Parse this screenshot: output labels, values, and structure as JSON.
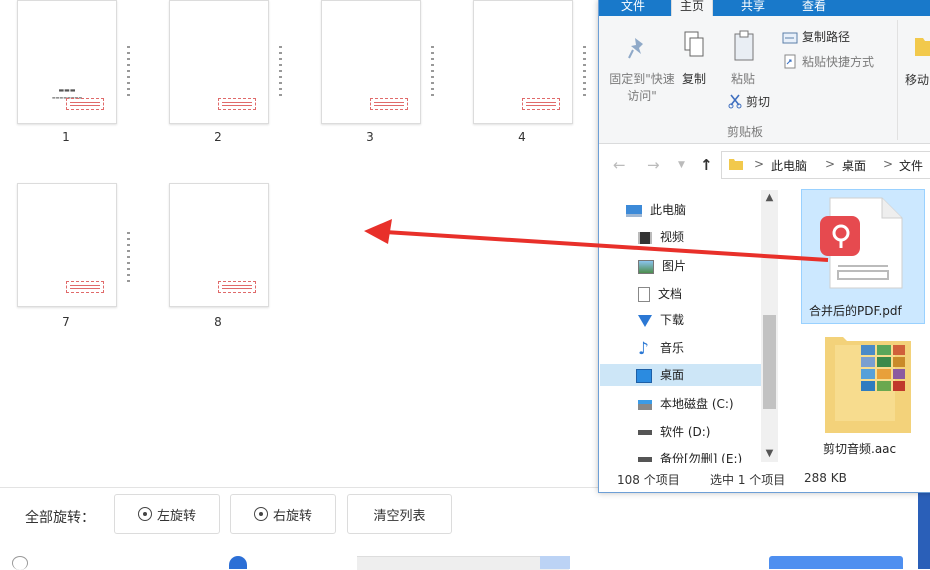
{
  "thumbnails": [
    {
      "page": "1"
    },
    {
      "page": "2"
    },
    {
      "page": "3"
    },
    {
      "page": "4"
    },
    {
      "page": "7"
    },
    {
      "page": "8"
    }
  ],
  "toolbar": {
    "rotate_all_label": "全部旋转：",
    "rotate_left": "左旋转",
    "rotate_right": "右旋转",
    "clear_list": "清空列表"
  },
  "explorer": {
    "tabs": [
      "文件",
      "主页",
      "共享",
      "查看"
    ],
    "ribbon": {
      "pin_quick_access": "固定到\"快速访问\"",
      "copy": "复制",
      "paste": "粘贴",
      "copy_path": "复制路径",
      "paste_shortcut": "粘贴快捷方式",
      "cut": "剪切",
      "move_to": "移动",
      "clipboard_group": "剪贴板"
    },
    "address": {
      "sep": ">",
      "crumbs": [
        "此电脑",
        "桌面",
        "文件"
      ]
    },
    "nav": [
      {
        "label": "此电脑"
      },
      {
        "label": "视频"
      },
      {
        "label": "图片"
      },
      {
        "label": "文档"
      },
      {
        "label": "下载"
      },
      {
        "label": "音乐"
      },
      {
        "label": "桌面"
      },
      {
        "label": "本地磁盘 (C:)"
      },
      {
        "label": "软件 (D:)"
      },
      {
        "label": "备份[勿删] (E:)"
      }
    ],
    "files": [
      {
        "name": "合并后的PDF.pdf",
        "icon": "pdf-file-icon",
        "selected": true
      },
      {
        "name": "剪切音频.aac",
        "icon": "folder-images-icon",
        "selected": false
      }
    ],
    "status": {
      "item_count": "108 个项目",
      "selected": "选中 1 个项目",
      "size": "288 KB"
    }
  },
  "colors": {
    "ribbon_blue": "#1979ca",
    "arrow_red": "#e8302a",
    "pdf_red": "#e64a4f"
  }
}
